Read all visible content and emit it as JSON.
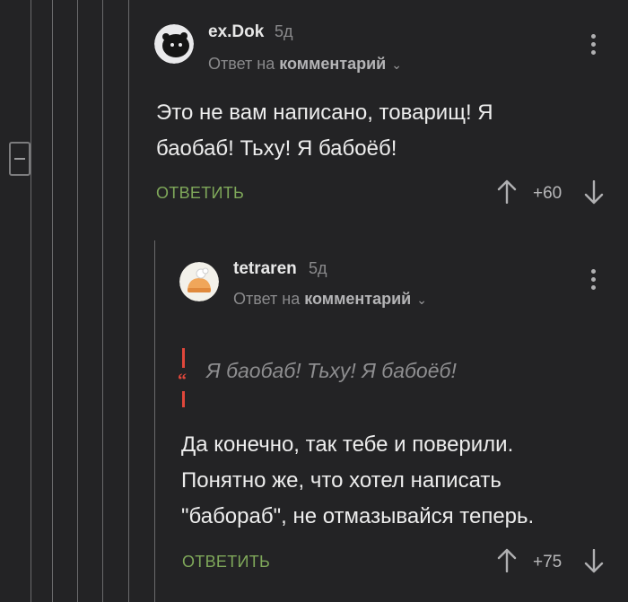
{
  "comments": [
    {
      "author": "ex.Dok",
      "age": "5д",
      "reply_prefix": "Ответ на",
      "reply_target": "комментарий",
      "text_lines": [
        "Это не вам написано, товарищ! Я",
        "баобаб! Тьху! Я бабоёб!"
      ],
      "reply_label": "ОТВЕТИТЬ",
      "rating": "+60"
    },
    {
      "author": "tetraren",
      "age": "5д",
      "reply_prefix": "Ответ на",
      "reply_target": "комментарий",
      "quote": "Я баобаб! Тьху! Я бабоёб!",
      "text_lines": [
        "Да конечно, так тебе и поверили.",
        "Понятно же, что хотел написать",
        "\"бабораб\", не отмазывайся теперь."
      ],
      "reply_label": "ОТВЕТИТЬ",
      "rating": "+75"
    }
  ],
  "icons": {
    "collapse": "minus-icon",
    "upvote": "arrow-up-icon",
    "downvote": "arrow-down-icon",
    "menu": "more-vertical-icon",
    "quote": "quote-icon"
  },
  "colors": {
    "background": "#232325",
    "reply_link": "#7fa85a",
    "thread_line": "#6a6a6c"
  }
}
